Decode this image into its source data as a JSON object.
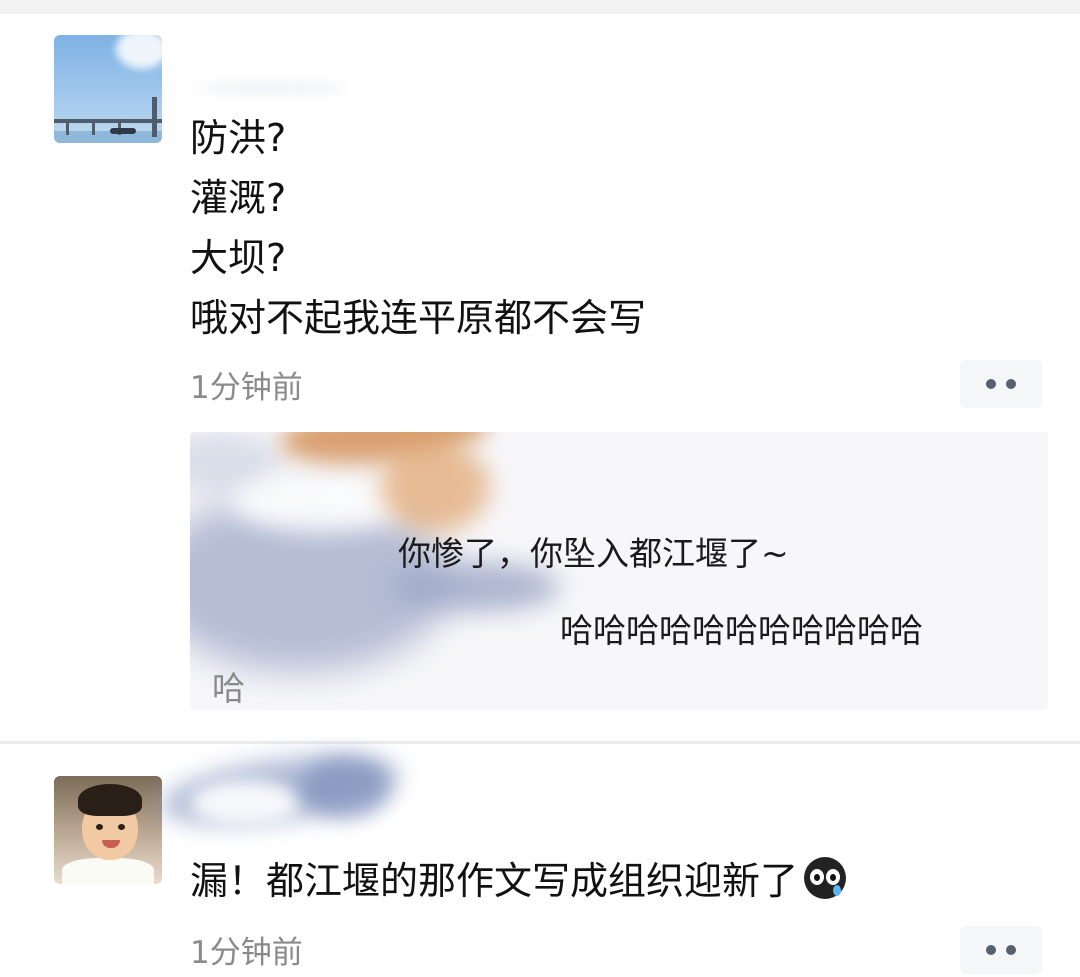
{
  "post1": {
    "text": "防洪?\n灌溉?\n大坝?\n哦对不起我连平原都不会写",
    "time": "1分钟前"
  },
  "reply": {
    "line1": "你惨了，你坠入都江堰了~",
    "line2": "哈哈哈哈哈哈哈哈哈哈哈",
    "line3": "哈"
  },
  "post2": {
    "text": "漏！都江堰的那作文写成组织迎新了",
    "emoji": "crying-face-icon",
    "time": "1分钟前"
  },
  "colors": {
    "time_text": "#8a8a8a",
    "reply_background": "#f7f7f9",
    "dots": "#58606e"
  }
}
